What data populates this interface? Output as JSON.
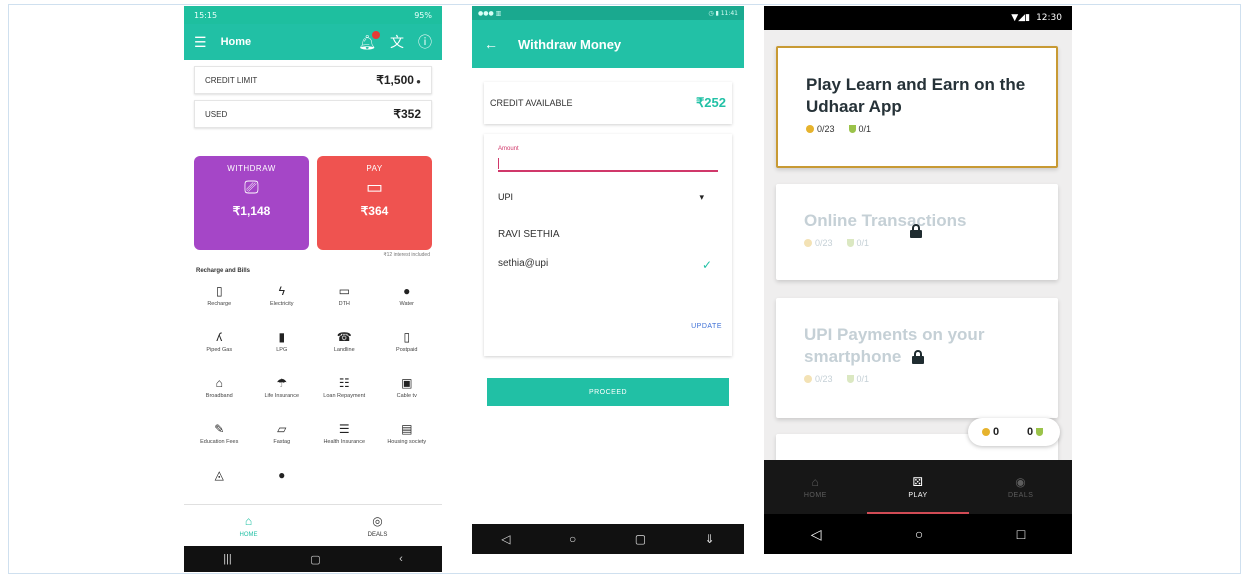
{
  "phone1": {
    "status": {
      "time": "15:15",
      "right": "95%"
    },
    "appbar": {
      "menu_icon": "menu-icon",
      "title": "Home",
      "icons": [
        "notification-icon",
        "translate-icon",
        "help-icon"
      ]
    },
    "credit_limit": {
      "label": "CREDIT LIMIT",
      "value": "₹1,500"
    },
    "used": {
      "label": "USED",
      "value": "₹352"
    },
    "withdraw": {
      "label": "WITHDRAW",
      "value": "₹1,148",
      "color": "#a546c7"
    },
    "pay": {
      "label": "PAY",
      "value": "₹364",
      "color": "#ef5350"
    },
    "pay_note": "₹12 interest included",
    "section_title": "Recharge and Bills",
    "services": [
      {
        "label": "Recharge",
        "icon": "▯"
      },
      {
        "label": "Electricity",
        "icon": "ϟ"
      },
      {
        "label": "DTH",
        "icon": "▭"
      },
      {
        "label": "Water",
        "icon": "●"
      },
      {
        "label": "Piped Gas",
        "icon": "ʎ"
      },
      {
        "label": "LPG",
        "icon": "▮"
      },
      {
        "label": "Landline",
        "icon": "☎"
      },
      {
        "label": "Postpaid",
        "icon": "▯"
      },
      {
        "label": "Broadband",
        "icon": "⌂"
      },
      {
        "label": "Life Insurance",
        "icon": "☂"
      },
      {
        "label": "Loan Repayment",
        "icon": "☷"
      },
      {
        "label": "Cable tv",
        "icon": "▣"
      },
      {
        "label": "Education Fees",
        "icon": "✎"
      },
      {
        "label": "Fastag",
        "icon": "▱"
      },
      {
        "label": "Health Insurance",
        "icon": "☰"
      },
      {
        "label": "Housing society",
        "icon": "▤"
      },
      {
        "label": "",
        "icon": "◬"
      },
      {
        "label": "",
        "icon": "●"
      }
    ],
    "bottom_nav": [
      {
        "label": "HOME",
        "icon": "⌂"
      },
      {
        "label": "DEALS",
        "icon": "◎"
      }
    ],
    "sys_nav": [
      "|||",
      "▢",
      "‹"
    ]
  },
  "phone2": {
    "status": {
      "left": "●●● ▥",
      "right": "◷ ▮ 11:41"
    },
    "appbar": {
      "back_icon": "←",
      "title": "Withdraw Money"
    },
    "credit": {
      "label": "CREDIT AVAILABLE",
      "value": "₹252"
    },
    "amount": {
      "label": "Amount",
      "value": ""
    },
    "method": {
      "value": "UPI",
      "icon": "▾"
    },
    "account_name": "RAVI SETHIA",
    "upi_id": "sethia@upi",
    "check_icon": "✓",
    "update_label": "UPDATE",
    "proceed_label": "PROCEED",
    "sys_nav": [
      "◁",
      "○",
      "▢",
      "⇓"
    ]
  },
  "phone3": {
    "status": {
      "icons": "▼◢▮",
      "time": "12:30"
    },
    "lessons": [
      {
        "title": "Play Learn and Earn on the Udhaar App",
        "coins": "0/23",
        "shields": "0/1",
        "locked": false
      },
      {
        "title": "Online Transactions",
        "coins": "0/23",
        "shields": "0/1",
        "locked": true
      },
      {
        "title": "UPI Payments on your smartphone",
        "coins": "0/23",
        "shields": "0/1",
        "locked": true
      }
    ],
    "totals": {
      "coins": "0",
      "shields": "0"
    },
    "bottom_nav": [
      {
        "label": "HOME",
        "icon": "⌂"
      },
      {
        "label": "PLAY",
        "icon": "⚄"
      },
      {
        "label": "DEALS",
        "icon": "◉"
      }
    ],
    "sys_nav": [
      "◁",
      "○",
      "□"
    ]
  }
}
